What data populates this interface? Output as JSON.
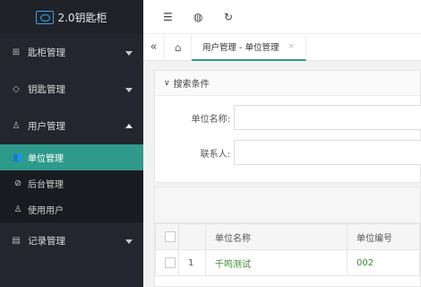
{
  "brand": {
    "title": "2.0钥匙柜"
  },
  "sidebar": {
    "items": [
      {
        "label": "匙柜管理",
        "icon": "grid-icon"
      },
      {
        "label": "钥匙管理",
        "icon": "tag-icon"
      },
      {
        "label": "用户管理",
        "icon": "user-icon"
      },
      {
        "label": "记录管理",
        "icon": "doc-icon"
      }
    ],
    "sub_items": [
      {
        "label": "单位管理",
        "icon": "users-icon"
      },
      {
        "label": "后台管理",
        "icon": "shield-icon"
      },
      {
        "label": "使用用户",
        "icon": "person-icon"
      }
    ]
  },
  "topbar": {
    "icons": [
      "menu-icon",
      "globe-icon",
      "refresh-icon"
    ]
  },
  "tabs": {
    "nav": "«",
    "home": "⌂",
    "active_tab": "用户管理 - 单位管理",
    "close": "×"
  },
  "search": {
    "title": "搜索条件",
    "fields": [
      {
        "label": "单位名称:",
        "value": ""
      },
      {
        "label": "联系人:",
        "value": ""
      }
    ]
  },
  "table": {
    "columns": [
      "",
      "",
      "单位名称",
      "单位编号"
    ],
    "rows": [
      {
        "index": "1",
        "name": "千鸣测试",
        "code": "002"
      }
    ]
  },
  "colors": {
    "accent": "#2e9a8b",
    "sidebar": "#23262e",
    "link_green": "#3a8c2e"
  }
}
